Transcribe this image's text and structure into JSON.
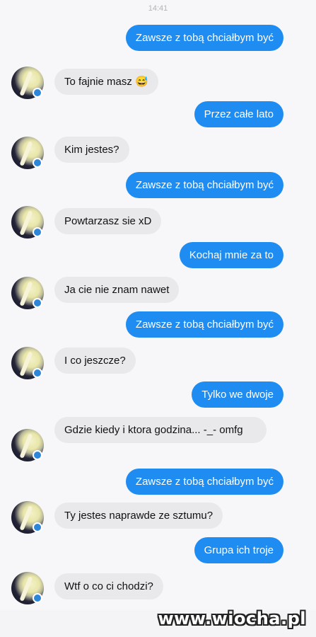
{
  "header": {
    "time": "14:41"
  },
  "messages": [
    {
      "dir": "out",
      "text": "Zawsze z tobą chciałbym być"
    },
    {
      "dir": "in",
      "text": "To fajnie masz 😅"
    },
    {
      "dir": "out",
      "text": "Przez całe lato"
    },
    {
      "dir": "in",
      "text": "Kim jestes?"
    },
    {
      "dir": "out",
      "text": "Zawsze z tobą chciałbym być"
    },
    {
      "dir": "in",
      "text": "Powtarzasz sie xD"
    },
    {
      "dir": "out",
      "text": "Kochaj mnie za to"
    },
    {
      "dir": "in",
      "text": "Ja cie nie znam nawet"
    },
    {
      "dir": "out",
      "text": "Zawsze z tobą chciałbym być"
    },
    {
      "dir": "in",
      "text": "I co jeszcze?"
    },
    {
      "dir": "out",
      "text": "Tylko we dwoje"
    },
    {
      "dir": "in",
      "text": "Gdzie kiedy i ktora godzina... -_- omfg"
    },
    {
      "dir": "out",
      "text": "Zawsze z tobą chciałbym być"
    },
    {
      "dir": "in",
      "text": "Ty jestes naprawde ze sztumu?"
    },
    {
      "dir": "out",
      "text": "Grupa ich troje"
    },
    {
      "dir": "in",
      "text": "Wtf o co ci chodzi?"
    }
  ],
  "watermark": "www.wiocha.pl",
  "colors": {
    "outgoing_bubble": "#1f8cf2",
    "incoming_bubble": "#e9e9ec"
  }
}
